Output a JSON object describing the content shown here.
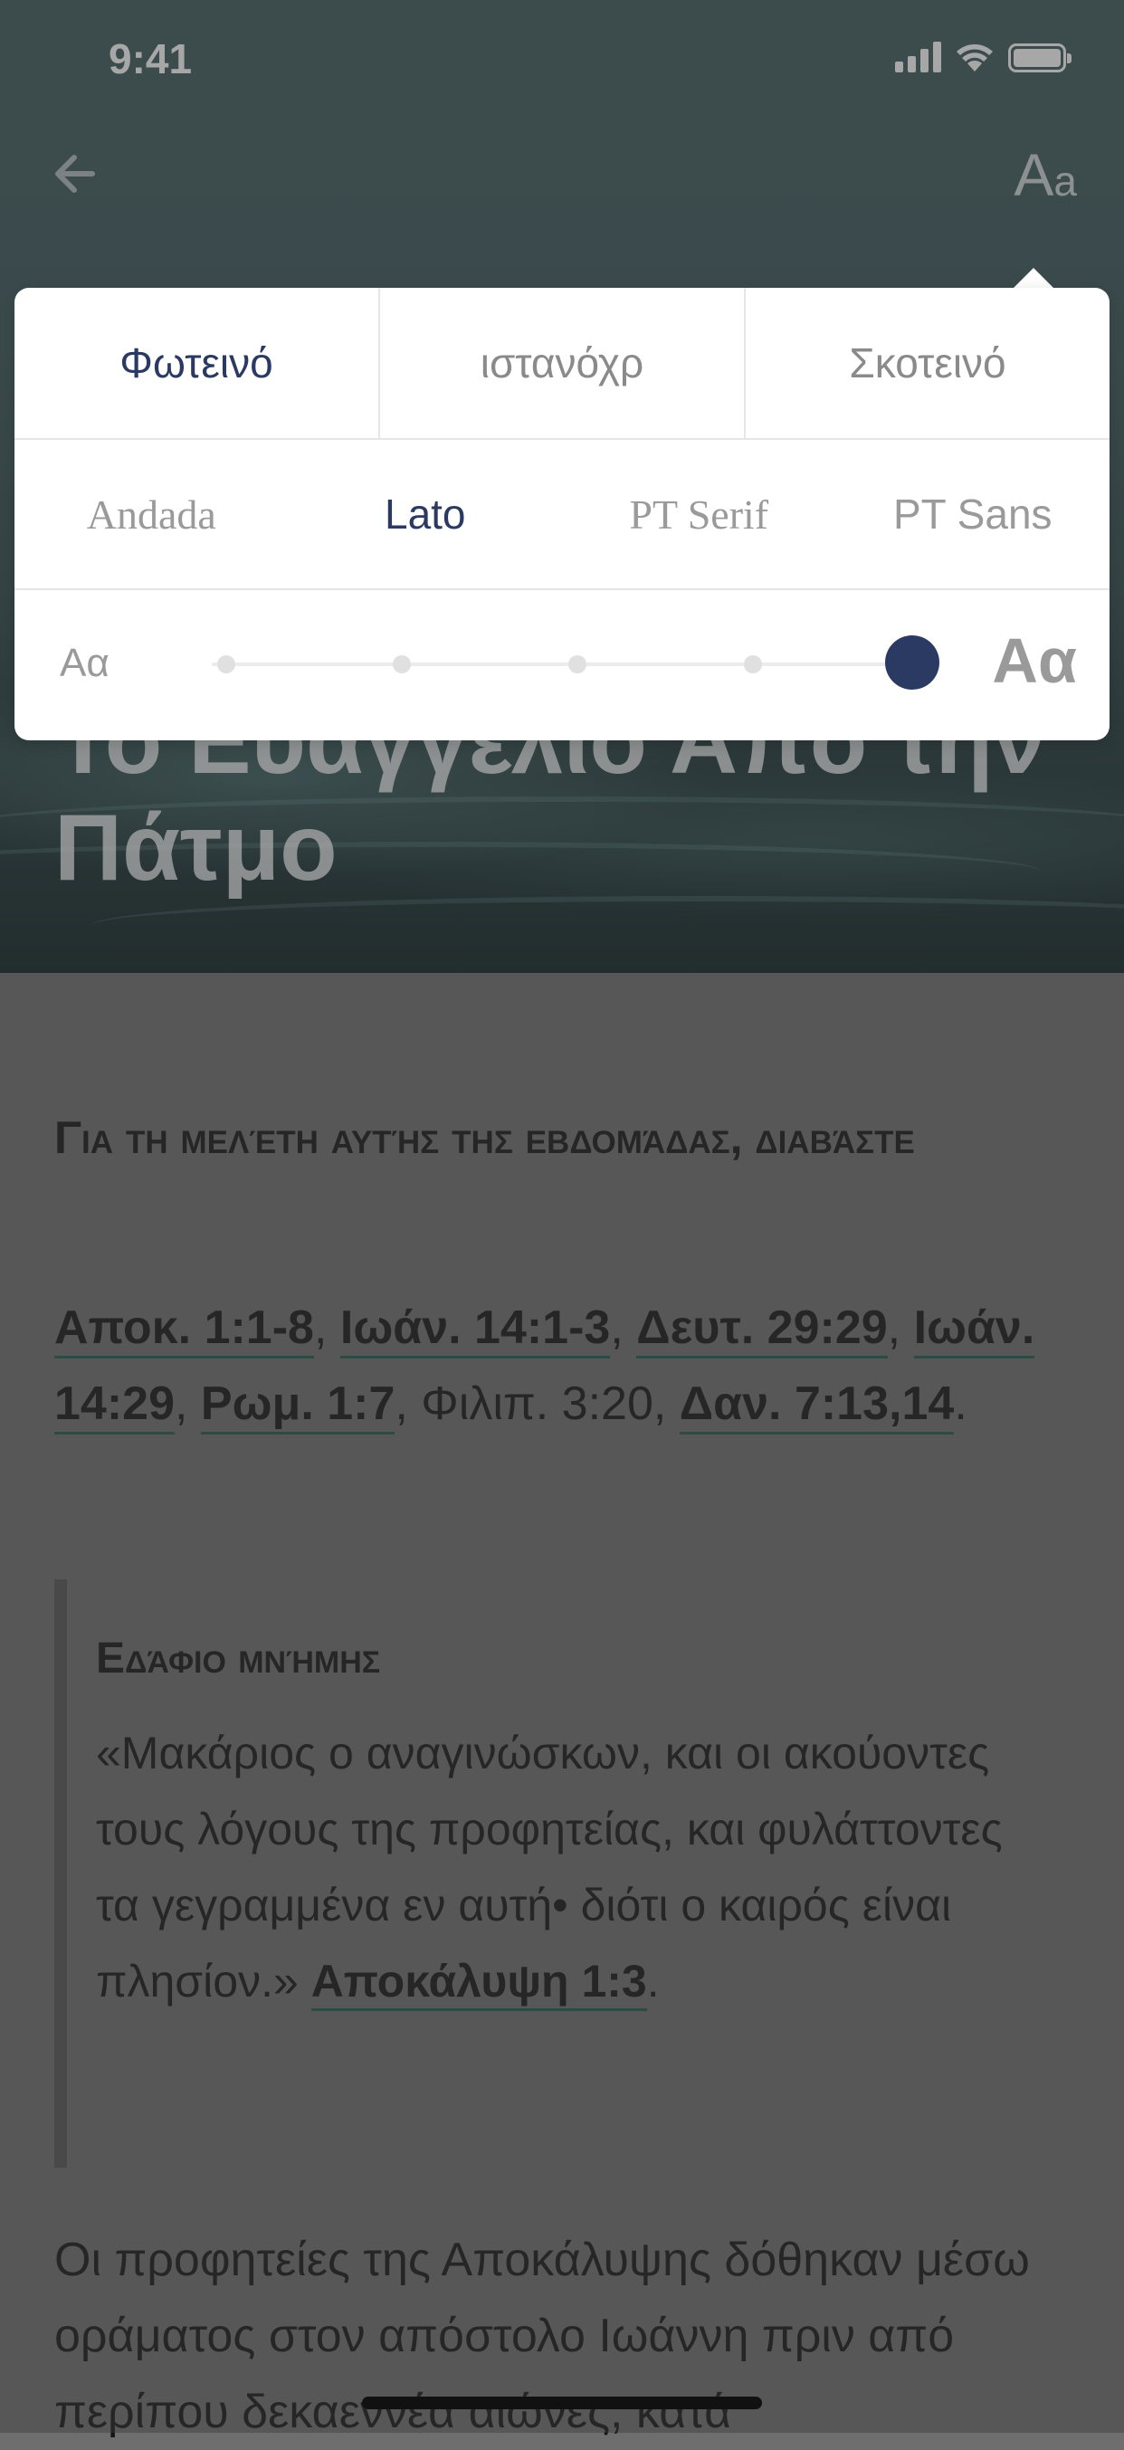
{
  "status_bar": {
    "time": "9:41"
  },
  "header": {
    "back_icon": "arrow-left-icon",
    "text_settings_big": "A",
    "text_settings_small": "a",
    "title": "Το Ευαγγέλιο Από την Πάτμο"
  },
  "settings": {
    "themes": [
      {
        "label": "Φωτεινό",
        "active": true
      },
      {
        "label": "ιστανόχρ",
        "active": false
      },
      {
        "label": "Σκοτεινό",
        "active": false
      }
    ],
    "fonts": [
      {
        "label": "Andada",
        "active": false
      },
      {
        "label": "Lato",
        "active": true
      },
      {
        "label": "PT Serif",
        "active": false
      },
      {
        "label": "PT Sans",
        "active": false
      }
    ],
    "size_small_label": "Aα",
    "size_large_label": "Aα",
    "size_level": 5,
    "size_levels": 5,
    "accent_color": "#2b3a63"
  },
  "content": {
    "study_heading": "Για τη μελέτη αυτής της εβδομάδας, διαβάστε",
    "references": [
      {
        "text": "Αποκ. 1:1-8",
        "linked": true
      },
      {
        "text": "Ιωάν. 14:1-3",
        "linked": true
      },
      {
        "text": "Δευτ. 29:29",
        "linked": true
      },
      {
        "text": "Ιωάν. 14:29",
        "linked": true
      },
      {
        "text": "Ρωμ. 1:7",
        "linked": true
      },
      {
        "text": "Φιλιπ. 3:20",
        "linked": false
      },
      {
        "text": "Δαν. 7:13,14",
        "linked": true
      }
    ],
    "separator": ", ",
    "terminator": ".",
    "memory_title": "Εδάφιο μνήμης",
    "memory_text": "«Μακάριος ο αναγινώσκων, και οι ακούοντες τους λόγους της προφητείας, και φυλάττοντες τα γεγραμμένα εν αυτή• διότι ο καιρός είναι πλησίον.»",
    "memory_ref": "Αποκάλυψη 1:3",
    "memory_ref_terminator": ".",
    "paragraph": "Οι προφητείες της Αποκάλυψης δόθηκαν μέσω οράματος στον απόστολο Ιωάννη πριν από περίπου δεκαεννέα αιώνες, κατά"
  }
}
